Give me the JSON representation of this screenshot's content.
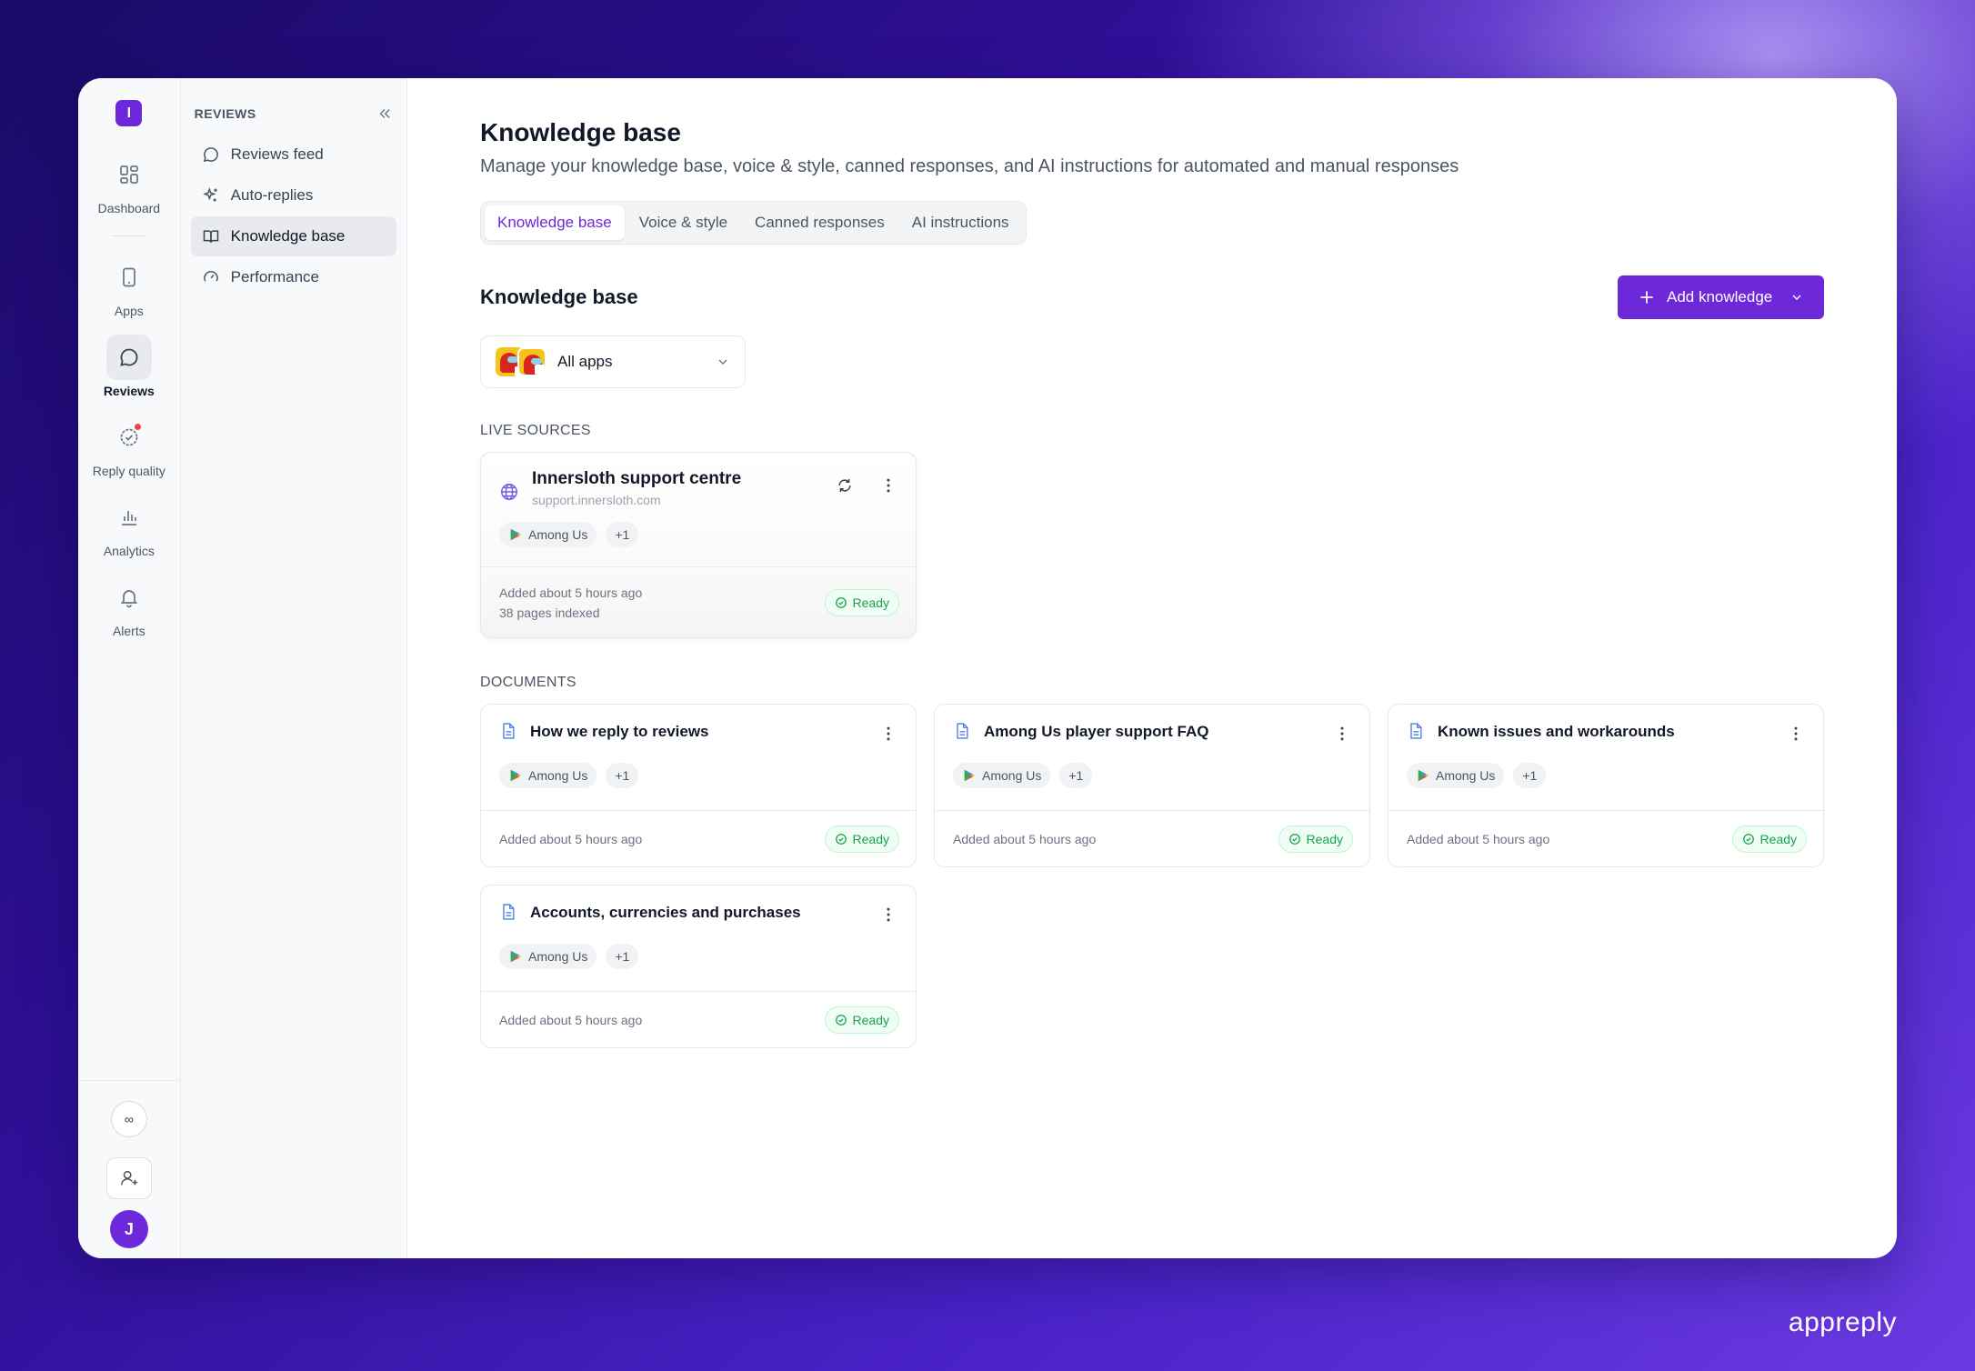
{
  "rail": {
    "logo_letter": "I",
    "items": [
      {
        "label": "Dashboard",
        "icon": "dashboard-icon"
      },
      {
        "label": "Apps",
        "icon": "phone-icon"
      },
      {
        "label": "Reviews",
        "icon": "chat-bubble-icon"
      },
      {
        "label": "Reply quality",
        "icon": "check-badge-icon"
      },
      {
        "label": "Analytics",
        "icon": "bar-chart-icon"
      },
      {
        "label": "Alerts",
        "icon": "bell-icon"
      }
    ],
    "bottom_circle": "∞",
    "avatar_letter": "J"
  },
  "subnav": {
    "title": "REVIEWS",
    "items": [
      {
        "label": "Reviews feed",
        "icon": "chat-bubble-icon"
      },
      {
        "label": "Auto-replies",
        "icon": "sparkles-icon"
      },
      {
        "label": "Knowledge base",
        "icon": "book-icon"
      },
      {
        "label": "Performance",
        "icon": "gauge-icon"
      }
    ]
  },
  "page": {
    "title": "Knowledge base",
    "subtitle": "Manage your knowledge base, voice & style, canned responses, and AI instructions for automated and manual responses",
    "tabs": [
      "Knowledge base",
      "Voice & style",
      "Canned responses",
      "AI instructions"
    ],
    "section_title": "Knowledge base",
    "add_button": "Add knowledge",
    "app_filter": "All apps"
  },
  "live_sources": {
    "label": "LIVE SOURCES",
    "items": [
      {
        "title": "Innersloth support centre",
        "url": "support.innersloth.com",
        "app": "Among Us",
        "extra": "+1",
        "added": "Added about 5 hours ago",
        "pages": "38 pages indexed",
        "status": "Ready"
      }
    ]
  },
  "documents": {
    "label": "DOCUMENTS",
    "items": [
      {
        "title": "How we reply to reviews",
        "app": "Among Us",
        "extra": "+1",
        "added": "Added about 5 hours ago",
        "status": "Ready"
      },
      {
        "title": "Among Us player support FAQ",
        "app": "Among Us",
        "extra": "+1",
        "added": "Added about 5 hours ago",
        "status": "Ready"
      },
      {
        "title": "Known issues and workarounds",
        "app": "Among Us",
        "extra": "+1",
        "added": "Added about 5 hours ago",
        "status": "Ready"
      },
      {
        "title": "Accounts, currencies and purchases",
        "app": "Among Us",
        "extra": "+1",
        "added": "Added about 5 hours ago",
        "status": "Ready"
      }
    ]
  },
  "brand": "appreply",
  "colors": {
    "accent": "#6d28d9",
    "ready": "#16a34a",
    "alert_dot": "#ef4444"
  }
}
